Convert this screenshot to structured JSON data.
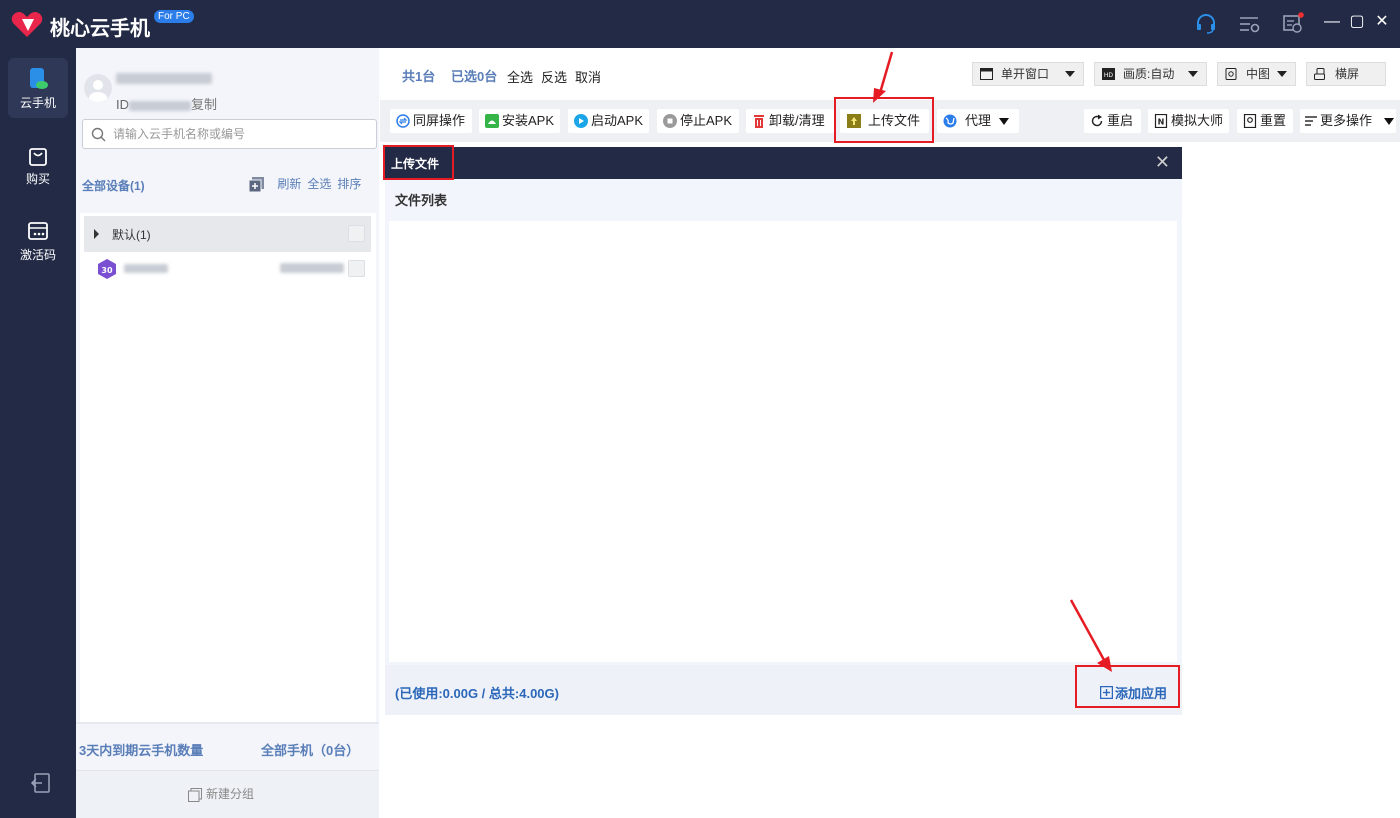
{
  "app": {
    "title": "桃心云手机",
    "badge": "For PC"
  },
  "rail": {
    "items": [
      {
        "label": "云手机"
      },
      {
        "label": "购买"
      },
      {
        "label": "激活码"
      }
    ]
  },
  "user": {
    "id_prefix": "ID",
    "copy_label": "复制"
  },
  "search": {
    "placeholder": "请输入云手机名称或编号"
  },
  "devices": {
    "header": "全部设备(1)",
    "refresh": "刷新",
    "select_all": "全选",
    "sort": "排序",
    "group_label": "默认(1)",
    "device_badge": "30"
  },
  "panel_footer": {
    "expiring": "3天内到期云手机数量",
    "all_phones": "全部手机（0台）",
    "new_group": "新建分组"
  },
  "summary": {
    "total": "共1台",
    "selected": "已选0台",
    "select_all": "全选",
    "invert": "反选",
    "cancel": "取消"
  },
  "view_controls": {
    "window_mode": "单开窗口",
    "quality": "画质:自动",
    "size": "中图",
    "orientation": "横屏"
  },
  "toolbar": {
    "sync": "同屏操作",
    "install_apk": "安装APK",
    "start_apk": "启动APK",
    "stop_apk": "停止APK",
    "uninstall": "卸载/清理",
    "upload": "上传文件",
    "proxy": "代理",
    "restart": "重启",
    "emulate": "模拟大师",
    "reset": "重置",
    "more": "更多操作"
  },
  "dialog": {
    "title": "上传文件",
    "file_list": "文件列表",
    "usage": "(已使用:0.00G / 总共:4.00G)",
    "add_app": "添加应用"
  },
  "colors": {
    "nav_bg": "#222a45",
    "accent": "#2a66b9",
    "highlight": "#e51c23"
  }
}
